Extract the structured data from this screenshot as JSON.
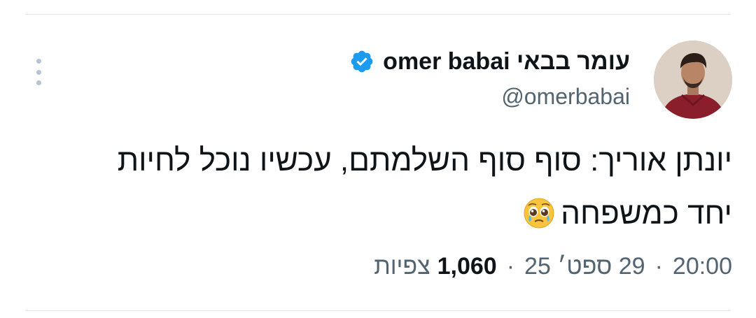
{
  "tweet": {
    "author": {
      "display_name": "עומר בבאי omer babai",
      "handle": "@omerbabai",
      "verified_color": "#1d9bf0",
      "avatar_icon": "profile-photo"
    },
    "text_line_1": "יונתן אוריך: סוף סוף השלמתם, עכשיו נוכל לחיות",
    "text_line_2": "יחד כמשפחה",
    "emoji": "pleading-face-emoji",
    "time": "20:00",
    "date": "29 ספט׳ 25",
    "views_count": "1,060",
    "views_label": "צפיות",
    "separator": "·"
  },
  "menu": {
    "more_icon": "more-vertical-icon"
  }
}
